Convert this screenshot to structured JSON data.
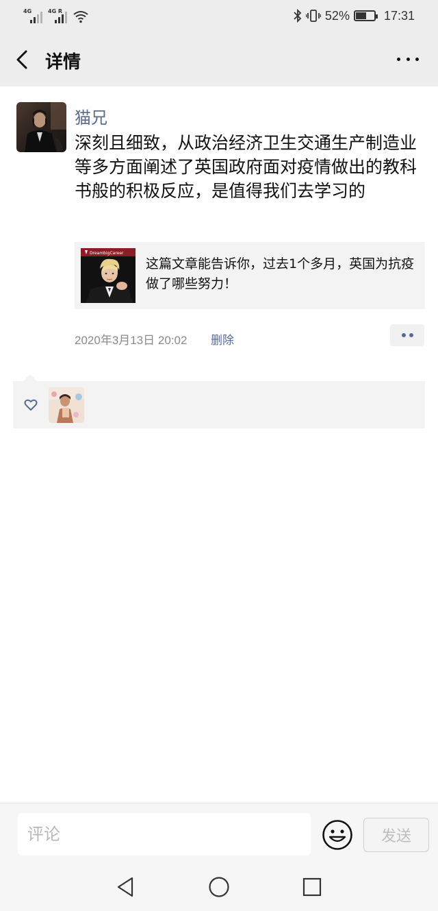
{
  "status_bar": {
    "signal1_label": "4G",
    "signal2_label": "4G R",
    "battery_percent": "52%",
    "battery_level": 0.52,
    "time": "17:31"
  },
  "header": {
    "title": "详情"
  },
  "post": {
    "username": "猫兄",
    "text": "深刻且细致，从政治经济卫生交通生产制造业等多方面阐述了英国政府面对疫情做出的教科书般的积极反应，是值得我们去学习的",
    "link_card": {
      "thumb_brand": "DreambigCareer",
      "title": "这篇文章能告诉你，过去1个多月，英国为抗疫做了哪些努力！"
    },
    "timestamp": "2020年3月13日 20:02",
    "delete_label": "删除"
  },
  "comment_bar": {
    "placeholder": "评论",
    "send_label": "发送"
  },
  "colors": {
    "link_blue": "#576b95",
    "header_bg": "#ededed",
    "panel_bg": "#f3f3f3"
  }
}
